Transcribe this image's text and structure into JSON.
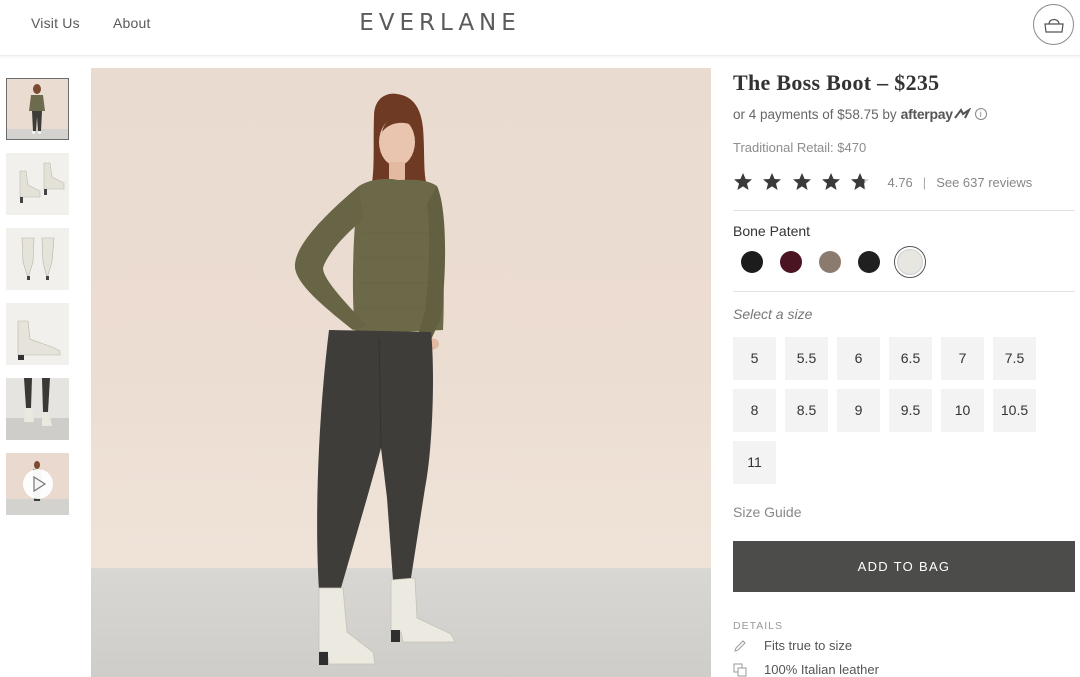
{
  "header": {
    "nav": [
      {
        "label": "Visit Us"
      },
      {
        "label": "About"
      }
    ],
    "logo": "EVERLANE",
    "cart_icon": "bag-icon"
  },
  "thumbnails": [
    {
      "alt": "model-full-body",
      "icon": "image"
    },
    {
      "alt": "boots-pair-side",
      "icon": "image"
    },
    {
      "alt": "boots-pair-front",
      "icon": "image"
    },
    {
      "alt": "boot-single-side",
      "icon": "image"
    },
    {
      "alt": "boots-on-legs",
      "icon": "image"
    },
    {
      "alt": "video",
      "icon": "play-icon"
    }
  ],
  "product": {
    "title": "The Boss Boot – $235",
    "afterpay_text": "or 4 payments of $58.75 by",
    "afterpay_brand": "afterpay",
    "traditional_retail": "Traditional Retail: $470",
    "rating": 4.76,
    "rating_label": "4.76",
    "rating_separator": "|",
    "reviews_label": "See 637 reviews",
    "selected_color_name": "Bone Patent",
    "colors": [
      {
        "name": "black",
        "hex": "#1c1c1c"
      },
      {
        "name": "burgundy",
        "hex": "#4a1422"
      },
      {
        "name": "taupe",
        "hex": "#8b7b6e"
      },
      {
        "name": "black-2",
        "hex": "#202020"
      },
      {
        "name": "bone-patent",
        "hex": "#e7e6e1",
        "selected": true
      }
    ],
    "select_size_label": "Select a size",
    "sizes": [
      "5",
      "5.5",
      "6",
      "6.5",
      "7",
      "7.5",
      "8",
      "8.5",
      "9",
      "9.5",
      "10",
      "10.5",
      "11"
    ],
    "size_guide_label": "Size Guide",
    "add_to_bag_label": "ADD TO BAG",
    "details_label": "DETAILS",
    "details": [
      {
        "icon": "pencil-icon",
        "text": "Fits true to size"
      },
      {
        "icon": "layers-icon",
        "text": "100% Italian leather"
      }
    ]
  },
  "colors": {
    "button_dark": "#4c4c4a",
    "star": "#3a3a3a",
    "size_bg": "#f3f3f3"
  }
}
